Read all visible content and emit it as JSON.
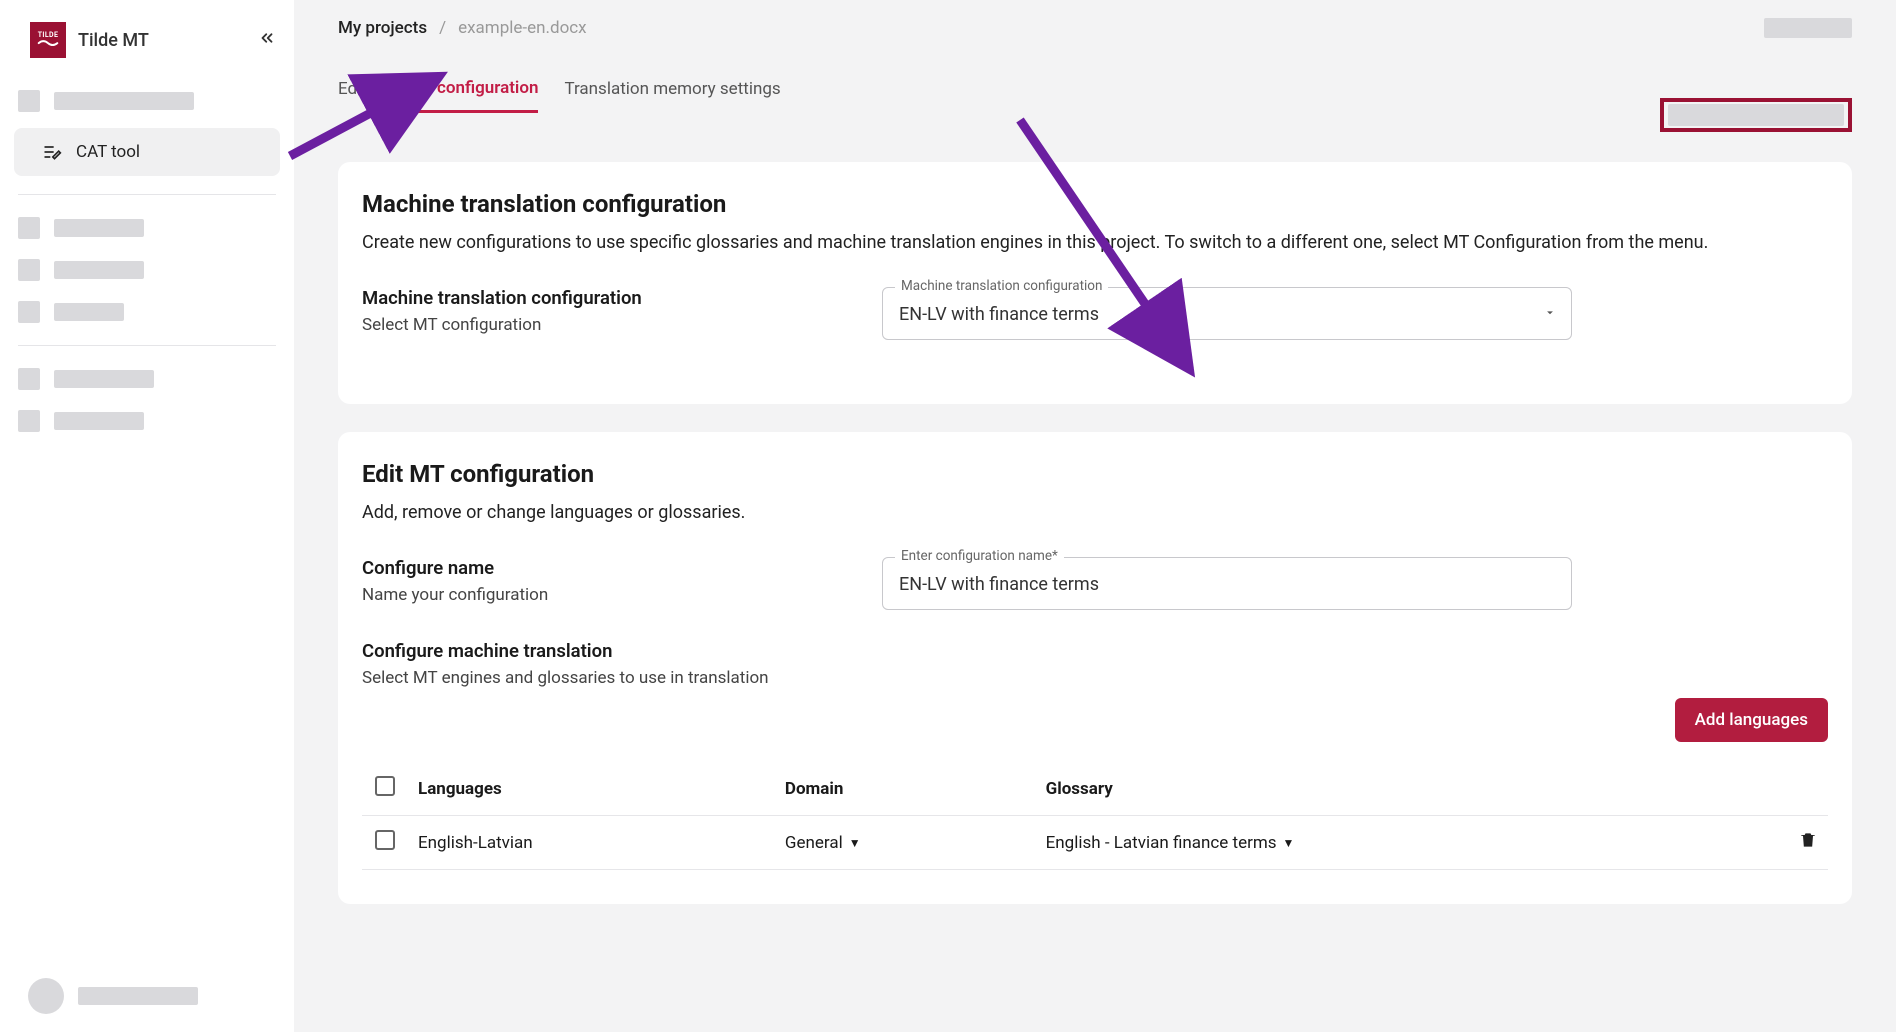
{
  "brand": "Tilde MT",
  "logo_text": "TILDE",
  "sidebar": {
    "cat_tool": "CAT tool"
  },
  "breadcrumb": {
    "root": "My projects",
    "leaf": "example-en.docx"
  },
  "tabs": {
    "editor": "Editor",
    "mt_config": "MT configuration",
    "tm_settings": "Translation memory settings"
  },
  "card1": {
    "title": "Machine translation configuration",
    "desc": "Create new configurations to use specific glossaries and machine translation engines in this project. To switch to a different one, select MT Configuration from the menu.",
    "field_title": "Machine translation configuration",
    "field_hint": "Select MT configuration",
    "select_label": "Machine translation configuration",
    "select_value": "EN-LV with finance terms"
  },
  "card2": {
    "title": "Edit MT configuration",
    "desc": "Add, remove or change languages or glossaries.",
    "name_title": "Configure name",
    "name_hint": "Name your configuration",
    "name_label": "Enter configuration name*",
    "name_value": "EN-LV with finance terms",
    "mt_title": "Configure machine translation",
    "mt_hint": "Select MT engines and glossaries to use in translation",
    "add_btn": "Add languages",
    "table": {
      "headers": {
        "languages": "Languages",
        "domain": "Domain",
        "glossary": "Glossary"
      },
      "row": {
        "languages": "English-Latvian",
        "domain": "General",
        "glossary": "English - Latvian finance terms"
      }
    }
  }
}
